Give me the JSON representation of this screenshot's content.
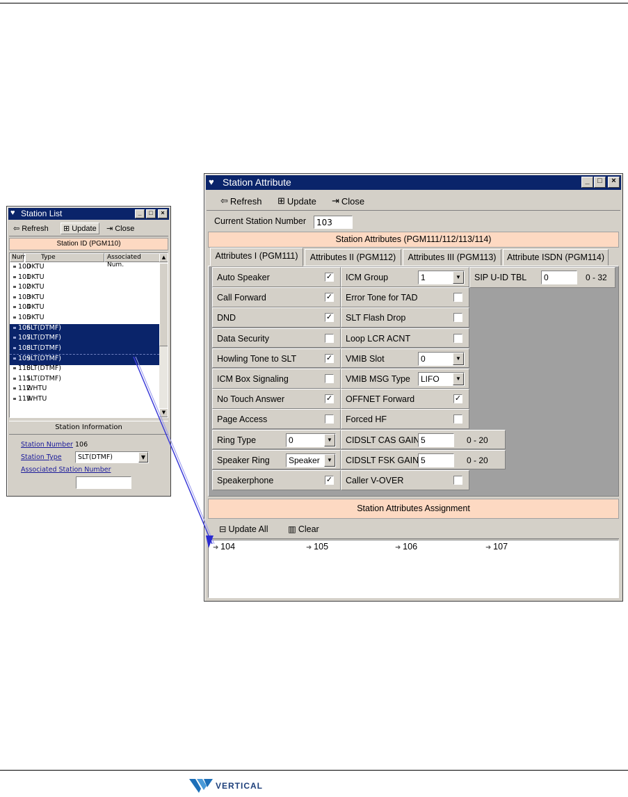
{
  "station_list": {
    "title": "Station List",
    "toolbar": {
      "refresh": "Refresh",
      "update": "Update",
      "close": "Close"
    },
    "section_header": "Station ID (PGM110)",
    "columns": [
      "Num.",
      "Type",
      "Associated Num."
    ],
    "rows": [
      {
        "num": "100",
        "type": "DKTU",
        "selected": false
      },
      {
        "num": "101",
        "type": "DKTU",
        "selected": false
      },
      {
        "num": "102",
        "type": "DKTU",
        "selected": false
      },
      {
        "num": "103",
        "type": "DKTU",
        "selected": false
      },
      {
        "num": "104",
        "type": "DKTU",
        "selected": false
      },
      {
        "num": "105",
        "type": "DKTU",
        "selected": false
      },
      {
        "num": "106",
        "type": "SLT(DTMF)",
        "selected": true
      },
      {
        "num": "107",
        "type": "SLT(DTMF)",
        "selected": true
      },
      {
        "num": "108",
        "type": "SLT(DTMF)",
        "selected": true
      },
      {
        "num": "109",
        "type": "SLT(DTMF)",
        "selected": true
      },
      {
        "num": "110",
        "type": "SLT(DTMF)",
        "selected": false
      },
      {
        "num": "111",
        "type": "SLT(DTMF)",
        "selected": false
      },
      {
        "num": "112",
        "type": "WHTU",
        "selected": false
      },
      {
        "num": "113",
        "type": "WHTU",
        "selected": false
      }
    ],
    "info_header": "Station Information",
    "station_number_label": "Station Number",
    "station_number_value": "106",
    "station_type_label": "Station Type",
    "station_type_value": "SLT(DTMF)",
    "associated_label": "Associated Station Number",
    "associated_value": ""
  },
  "station_attribute": {
    "title": "Station Attribute",
    "toolbar": {
      "refresh": "Refresh",
      "update": "Update",
      "close": "Close"
    },
    "current_station_label": "Current Station Number",
    "current_station_value": "103",
    "section_header": "Station Attributes (PGM111/112/113/114)",
    "tabs": [
      {
        "label": "Attributes I (PGM111)",
        "active": true
      },
      {
        "label": "Attributes II (PGM112)",
        "active": false
      },
      {
        "label": "Attributes III (PGM113)",
        "active": false
      },
      {
        "label": "Attribute ISDN (PGM114)",
        "active": false
      }
    ],
    "col1": [
      {
        "label": "Auto Speaker",
        "kind": "check",
        "checked": true
      },
      {
        "label": "Call Forward",
        "kind": "check",
        "checked": true
      },
      {
        "label": "DND",
        "kind": "check",
        "checked": true
      },
      {
        "label": "Data Security",
        "kind": "check",
        "checked": false
      },
      {
        "label": "Howling Tone to SLT",
        "kind": "check",
        "checked": true
      },
      {
        "label": "ICM Box Signaling",
        "kind": "check",
        "checked": false
      },
      {
        "label": "No Touch Answer",
        "kind": "check",
        "checked": true
      },
      {
        "label": "Page Access",
        "kind": "check",
        "checked": false
      },
      {
        "label": "Ring Type",
        "kind": "combo",
        "value": "0"
      },
      {
        "label": "Speaker Ring",
        "kind": "combo",
        "value": "Speaker"
      },
      {
        "label": "Speakerphone",
        "kind": "check",
        "checked": true
      }
    ],
    "col2": [
      {
        "label": "ICM Group",
        "kind": "combo",
        "value": "1"
      },
      {
        "label": "Error Tone for TAD",
        "kind": "check",
        "checked": false
      },
      {
        "label": "SLT Flash Drop",
        "kind": "check",
        "checked": false
      },
      {
        "label": "Loop LCR ACNT",
        "kind": "check",
        "checked": false
      },
      {
        "label": "VMIB Slot",
        "kind": "combo",
        "value": "0"
      },
      {
        "label": "VMIB MSG Type",
        "kind": "combo",
        "value": "LIFO"
      },
      {
        "label": "OFFNET Forward",
        "kind": "check",
        "checked": true
      },
      {
        "label": "Forced HF",
        "kind": "check",
        "checked": false
      },
      {
        "label": "CIDSLT CAS GAIN",
        "kind": "input",
        "value": "5",
        "range": "0 - 20"
      },
      {
        "label": "CIDSLT FSK GAIN",
        "kind": "input",
        "value": "5",
        "range": "0 - 20"
      },
      {
        "label": "Caller V-OVER",
        "kind": "check",
        "checked": false
      }
    ],
    "sip": {
      "label": "SIP U-ID TBL",
      "value": "0",
      "range": "0 - 32"
    },
    "assign_header": "Station Attributes Assignment",
    "assign_toolbar": {
      "update_all": "Update All",
      "clear": "Clear"
    },
    "assigned": [
      "104",
      "105",
      "106",
      "107"
    ]
  },
  "footer": {
    "logo_text": "VERTICAL"
  },
  "colors": {
    "selection": "#0a246a",
    "peach": "#fdd9c2",
    "face": "#d4d0c8",
    "arrow": "#3b3bd8"
  }
}
